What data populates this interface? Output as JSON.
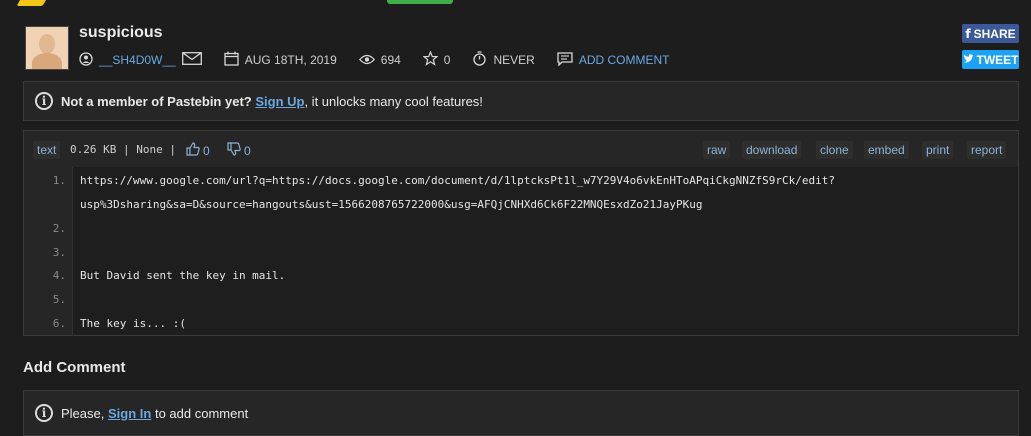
{
  "paste": {
    "title": "suspicious",
    "author": "__SH4D0W__",
    "date": "AUG 18TH, 2019",
    "views": "694",
    "stars": "0",
    "expiry": "NEVER",
    "add_comment": "ADD COMMENT"
  },
  "social": {
    "share": "SHARE",
    "tweet": "TWEET"
  },
  "notice": {
    "prefix": "Not a member of Pastebin yet?",
    "link": "Sign Up",
    "suffix": ", it unlocks many cool features!"
  },
  "toolbar": {
    "syntax": "text",
    "info": "0.26 KB | None |",
    "likes": "0",
    "dislikes": "0",
    "buttons": [
      "raw",
      "download",
      "clone",
      "embed",
      "print",
      "report"
    ]
  },
  "code_lines": [
    {
      "num": "1.",
      "text": "https://www.google.com/url?q=https://docs.google.com/document/d/1lptcksPt1l_w7Y29V4o6vkEnHToAPqiCkgNNZfS9rCk/edit?"
    },
    {
      "num": "",
      "text": "usp%3Dsharing&sa=D&source=hangouts&ust=1566208765722000&usg=AFQjCNHXd6Ck6F22MNQEsxdZo21JayPKug"
    },
    {
      "num": "2.",
      "text": ""
    },
    {
      "num": "3.",
      "text": ""
    },
    {
      "num": "4.",
      "text": "But David sent the key in mail."
    },
    {
      "num": "5.",
      "text": ""
    },
    {
      "num": "6.",
      "text": "The key is... :("
    }
  ],
  "comments": {
    "heading": "Add Comment",
    "please": "Please,",
    "signin": "Sign In",
    "suffix": "to add comment"
  },
  "colors": {
    "link": "#6aa8e0",
    "facebook": "#3b5998",
    "twitter": "#1da1f2"
  }
}
